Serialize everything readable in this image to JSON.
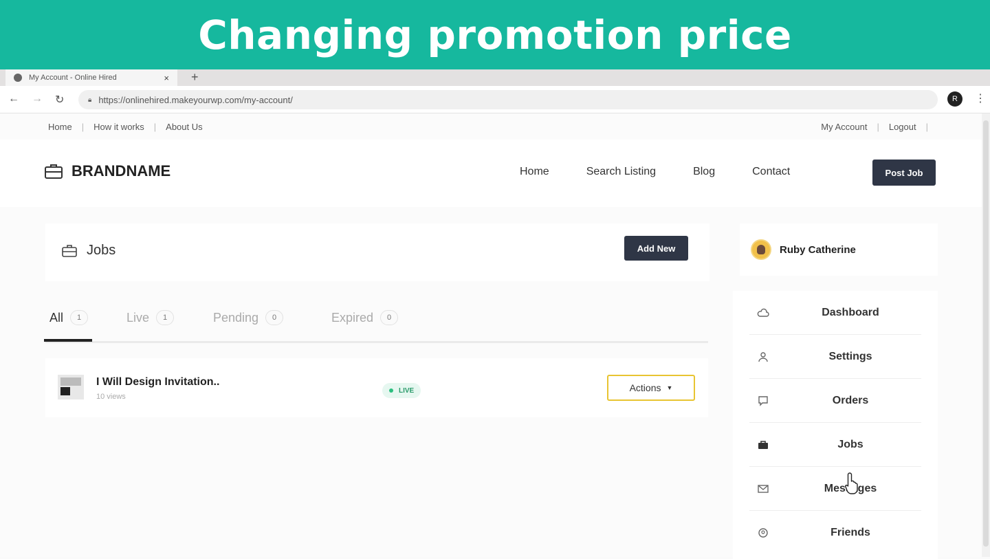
{
  "banner": {
    "title": "Changing promotion price"
  },
  "browser": {
    "tab_title": "My Account - Online Hired",
    "tab_close": "×",
    "new_tab": "+",
    "url": "https://onlinehired.makeyourwp.com/my-account/",
    "profile_initial": "R"
  },
  "utility_nav": {
    "left": [
      "Home",
      "How it works",
      "About Us"
    ],
    "right": [
      "My Account",
      "Logout"
    ]
  },
  "site": {
    "brand": "BRANDNAME",
    "nav": [
      "Home",
      "Search Listing",
      "Blog",
      "Contact"
    ],
    "post_job": "Post Job"
  },
  "jobs_header": {
    "title": "Jobs",
    "add_new": "Add New"
  },
  "tabs": [
    {
      "label": "All",
      "count": "1"
    },
    {
      "label": "Live",
      "count": "1"
    },
    {
      "label": "Pending",
      "count": "0"
    },
    {
      "label": "Expired",
      "count": "0"
    }
  ],
  "job": {
    "title": "I Will Design Invitation..",
    "views": "10 views",
    "status": "LIVE",
    "actions": "Actions"
  },
  "user": {
    "name": "Ruby Catherine"
  },
  "menu": [
    {
      "label": "Dashboard",
      "icon": "cloud-icon"
    },
    {
      "label": "Settings",
      "icon": "user-icon"
    },
    {
      "label": "Orders",
      "icon": "chat-icon"
    },
    {
      "label": "Jobs",
      "icon": "briefcase-icon"
    },
    {
      "label": "Messages",
      "icon": "mail-icon"
    },
    {
      "label": "Friends",
      "icon": "friends-icon"
    }
  ],
  "colors": {
    "banner": "#16b89e",
    "dark_button": "#2f3646",
    "actions_border": "#e8c431",
    "live": "#2bbf7f"
  }
}
